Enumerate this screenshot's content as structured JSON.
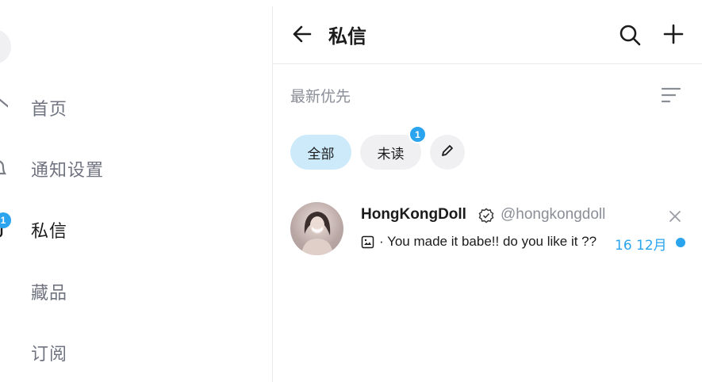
{
  "sidebar": {
    "items": [
      {
        "label": "首页",
        "icon": "home-icon"
      },
      {
        "label": "通知设置",
        "icon": "bell-icon"
      },
      {
        "label": "私信",
        "icon": "message-icon",
        "badge": "1",
        "active": true
      },
      {
        "label": "藏品",
        "icon": "collection-icon"
      },
      {
        "label": "订阅",
        "icon": "subscription-icon"
      }
    ]
  },
  "header": {
    "title": "私信",
    "back_icon": "arrow-left-icon",
    "search_icon": "search-icon",
    "add_icon": "plus-icon"
  },
  "sort": {
    "label": "最新优先",
    "icon": "sort-icon"
  },
  "filters": {
    "all_label": "全部",
    "unread_label": "未读",
    "unread_badge": "1",
    "edit_icon": "pencil-icon"
  },
  "messages": [
    {
      "name": "HongKongDoll",
      "handle": "@hongkongdoll",
      "verified": true,
      "preview": "· You made it babe!! do you like it ??",
      "date": "16 12月",
      "unread": true
    }
  ],
  "colors": {
    "accent": "#2aa4ee",
    "chip_active": "#cdeafb",
    "chip_inactive": "#f0f0f2",
    "muted_text": "#8a8e97"
  }
}
